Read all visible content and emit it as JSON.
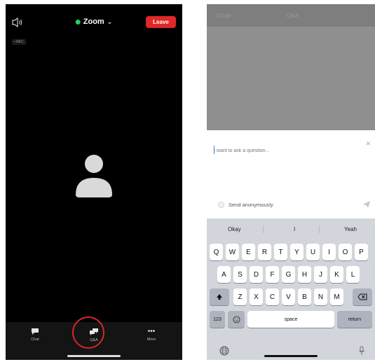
{
  "left_screen": {
    "meeting_title": "Zoom",
    "leave_label": "Leave",
    "tiny_label": "• REC",
    "toolbar": [
      {
        "name": "chat",
        "label": "Chat",
        "icon": "chat-bubble-icon"
      },
      {
        "name": "qa",
        "label": "Q&A",
        "icon": "qa-bubbles-icon"
      },
      {
        "name": "more",
        "label": "More",
        "icon": "more-dots-icon"
      }
    ],
    "highlight_color": "#d42626"
  },
  "right_screen": {
    "header": {
      "close_label": "Close",
      "title": "Q&A"
    },
    "question_placeholder": "I want to ask a question...",
    "send_anonymously_label": "Send anonymously",
    "predictions": [
      "Okay",
      "I",
      "Yeah"
    ],
    "keyboard": {
      "row1": [
        "Q",
        "W",
        "E",
        "R",
        "T",
        "Y",
        "U",
        "I",
        "O",
        "P"
      ],
      "row2": [
        "A",
        "S",
        "D",
        "F",
        "G",
        "H",
        "J",
        "K",
        "L"
      ],
      "row3": [
        "Z",
        "X",
        "C",
        "V",
        "B",
        "N",
        "M"
      ],
      "numbers_key": "123",
      "space_key": "space",
      "return_key": "return"
    }
  }
}
